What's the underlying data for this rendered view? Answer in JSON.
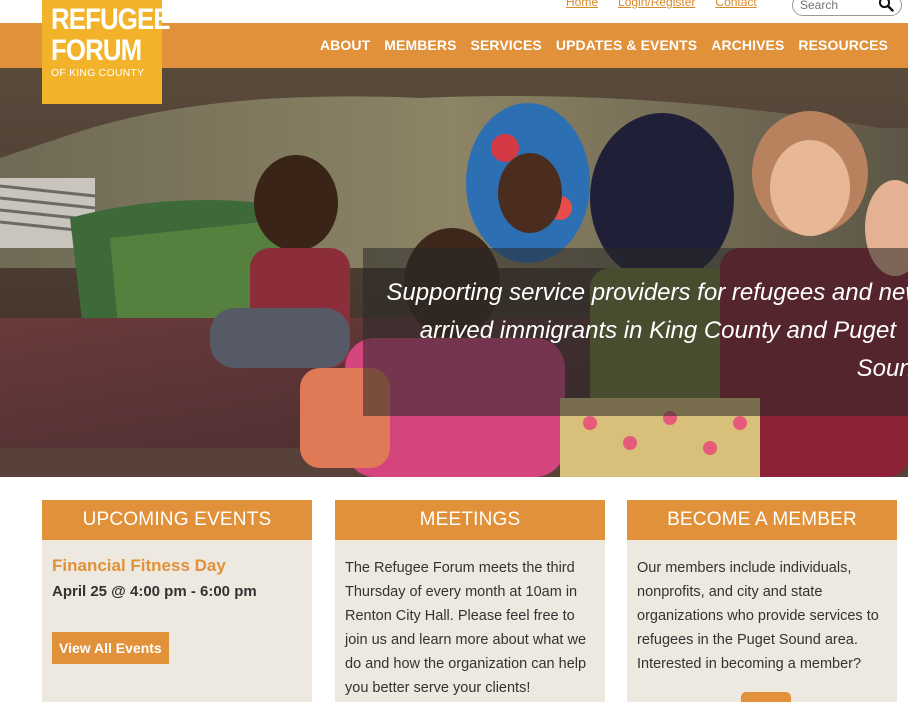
{
  "logo": {
    "line1": "REFUGEE",
    "line2": "FORUM",
    "line3": "OF KING COUNTY"
  },
  "util_links": {
    "home": "Home",
    "login": "Login/Register",
    "contact": "Contact"
  },
  "search": {
    "placeholder": "Search"
  },
  "nav": {
    "items": [
      "ABOUT",
      "MEMBERS",
      "SERVICES",
      "UPDATES & EVENTS",
      "ARCHIVES",
      "RESOURCES"
    ]
  },
  "hero": {
    "tagline_line1": "Supporting service providers for refugees and newly",
    "tagline_line2": "arrived immigrants in King County and Puget",
    "tagline_line3": "Sound"
  },
  "events": {
    "heading": "UPCOMING EVENTS",
    "event_title": "Financial Fitness Day",
    "event_time": "April 25 @ 4:00 pm - 6:00 pm",
    "button": "View All Events"
  },
  "meetings": {
    "heading": "MEETINGS",
    "text": "The Refugee Forum meets the third Thursday of every month at 10am in Renton City Hall. Please feel free to join us and learn more about what we do and how the organization can help you better serve your clients!"
  },
  "member": {
    "heading": "BECOME A MEMBER",
    "text": "Our members include individuals, nonprofits, and city and state organizations who provide services to refugees in the Puget Sound area. Interested in becoming a member?"
  },
  "colors": {
    "accent": "#e0913a",
    "logo": "#f2b32a",
    "panel": "#ede8e0"
  }
}
